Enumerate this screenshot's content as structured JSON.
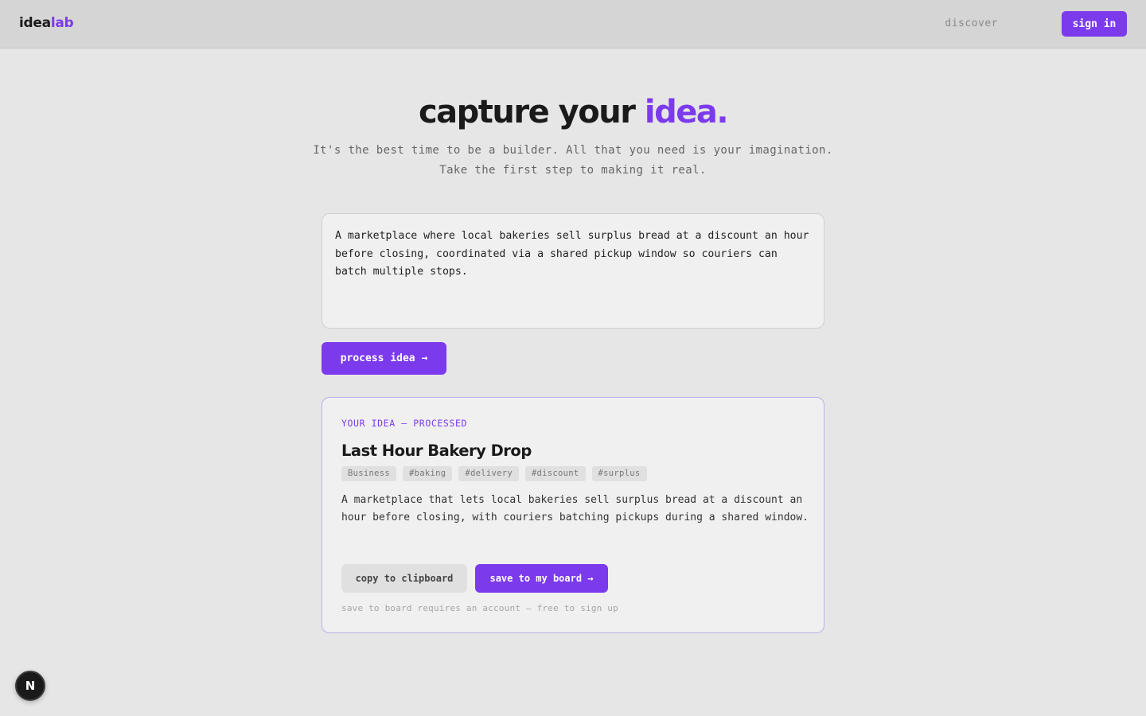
{
  "header": {
    "logo_part1": "idea",
    "logo_part2": "lab",
    "nav_discover": "discover",
    "signin_label": "sign in"
  },
  "hero": {
    "title_main": "capture your ",
    "title_accent": "idea.",
    "subtitle_line1": "It's the best time to be a builder. All that you need is your imagination.",
    "subtitle_line2": "Take the first step to making it real."
  },
  "input": {
    "value": "A marketplace where local bakeries sell surplus bread at a discount an hour before closing, coordinated via a shared pickup window so couriers can batch multiple stops."
  },
  "process_button_label": "process idea →",
  "result": {
    "eyebrow": "YOUR IDEA — PROCESSED",
    "title": "Last Hour Bakery Drop",
    "tags": [
      "Business",
      "#baking",
      "#delivery",
      "#discount",
      "#surplus"
    ],
    "description": "A marketplace that lets local bakeries sell surplus bread at a discount an hour before closing, with couriers batching pickups during a shared window.",
    "copy_label": "copy to clipboard",
    "save_label": "save to my board →",
    "note": "save to board requires an account — free to sign up"
  },
  "badge": {
    "letter": "N",
    "icon": "nextjs-icon"
  },
  "colors": {
    "accent": "#7c3aed",
    "background": "#e6e6e6",
    "topbar": "#d5d5d5"
  }
}
